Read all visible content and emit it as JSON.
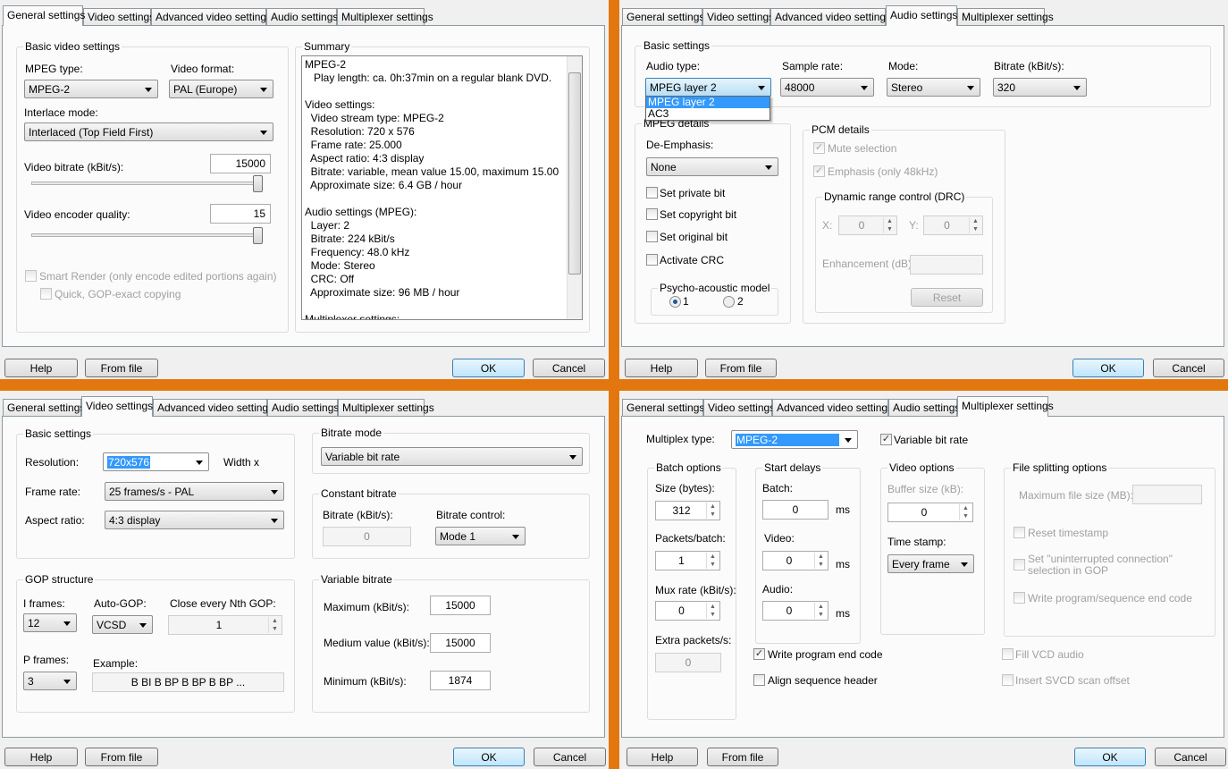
{
  "tabs": [
    "General settings",
    "Video settings",
    "Advanced video settings",
    "Audio settings",
    "Multiplexer settings"
  ],
  "buttons": {
    "help": "Help",
    "from_file": "From file",
    "ok": "OK",
    "cancel": "Cancel"
  },
  "accent_color": "#e2770f",
  "general": {
    "basic_group": "Basic video settings",
    "mpeg_type_label": "MPEG type:",
    "mpeg_type": "MPEG-2",
    "video_format_label": "Video format:",
    "video_format": "PAL (Europe)",
    "interlace_label": "Interlace mode:",
    "interlace": "Interlaced (Top Field First)",
    "bitrate_label": "Video bitrate (kBit/s):",
    "bitrate": "15000",
    "bitrate_slider_percent": 100,
    "quality_label": "Video encoder quality:",
    "quality": "15",
    "quality_slider_percent": 100,
    "smart_render": "Smart Render (only encode edited portions again)",
    "quick_gop": "Quick, GOP-exact copying",
    "summary_group": "Summary",
    "summary_text": "MPEG-2\n   Play length: ca. 0h:37min on a regular blank DVD.\n\nVideo settings:\n  Video stream type: MPEG-2\n  Resolution: 720 x 576\n  Frame rate: 25.000\n  Aspect ratio: 4:3 display\n  Bitrate: variable, mean value 15.00, maximum 15.00\n  Approximate size: 6.4 GB / hour\n\nAudio settings (MPEG):\n  Layer: 2\n  Bitrate: 224 kBit/s\n  Frequency: 48.0 kHz\n  Mode: Stereo\n  CRC: Off\n  Approximate size: 96 MB / hour\n\nMultiplexer settings:"
  },
  "audio": {
    "basic_group": "Basic settings",
    "audio_type_label": "Audio type:",
    "audio_type": "MPEG layer 2",
    "audio_type_options": [
      "MPEG layer 2",
      "AC3"
    ],
    "sample_rate_label": "Sample rate:",
    "sample_rate": "48000",
    "mode_label": "Mode:",
    "mode": "Stereo",
    "bitrate_label": "Bitrate (kBit/s):",
    "bitrate": "320",
    "mpeg_group": "MPEG details",
    "deemphasis_label": "De-Emphasis:",
    "deemphasis": "None",
    "private_bit": "Set private bit",
    "copyright_bit": "Set copyright bit",
    "original_bit": "Set original bit",
    "crc": "Activate CRC",
    "psycho_group": "Psycho-acoustic model",
    "psycho_1": "1",
    "psycho_2": "2",
    "pcm_group": "PCM details",
    "mute": "Mute selection",
    "emphasis": "Emphasis (only 48kHz)",
    "drc_group": "Dynamic range control (DRC)",
    "x_label": "X:",
    "x": "0",
    "y_label": "Y:",
    "y": "0",
    "enhancement_label": "Enhancement (dB)",
    "reset": "Reset"
  },
  "video": {
    "basic_group": "Basic settings",
    "resolution_label": "Resolution:",
    "resolution": "720x576",
    "width_label": "Width x",
    "frame_rate_label": "Frame rate:",
    "frame_rate": "25 frames/s - PAL",
    "aspect_label": "Aspect ratio:",
    "aspect": "4:3 display",
    "gop_group": "GOP structure",
    "i_frames_label": "I frames:",
    "i_frames": "12",
    "auto_gop_label": "Auto-GOP:",
    "auto_gop": "VCSD",
    "close_gop_label": "Close every Nth GOP:",
    "close_gop": "1",
    "p_frames_label": "P frames:",
    "p_frames": "3",
    "example_label": "Example:",
    "example": "B BI B BP B BP B BP ...",
    "bitrate_mode_group": "Bitrate mode",
    "bitrate_mode": "Variable bit rate",
    "constant_group": "Constant bitrate",
    "cbr_label": "Bitrate (kBit/s):",
    "cbr": "0",
    "control_label": "Bitrate control:",
    "control": "Mode 1",
    "variable_group": "Variable bitrate",
    "max_label": "Maximum (kBit/s):",
    "max": "15000",
    "medium_label": "Medium value (kBit/s):",
    "medium": "15000",
    "min_label": "Minimum (kBit/s):",
    "min": "1874"
  },
  "mux": {
    "type_label": "Multiplex type:",
    "type": "MPEG-2",
    "vbr": "Variable bit rate",
    "batch_group": "Batch options",
    "size_label": "Size (bytes):",
    "size": "312",
    "packets_label": "Packets/batch:",
    "packets": "1",
    "muxrate_label": "Mux rate (kBit/s):",
    "muxrate": "0",
    "extra_label": "Extra packets/s:",
    "extra": "0",
    "delays_group": "Start delays",
    "batch_label": "Batch:",
    "batch": "0",
    "video_label": "Video:",
    "video": "0",
    "audio_label": "Audio:",
    "audio": "0",
    "ms": "ms",
    "write_end": "Write program end code",
    "align_seq": "Align sequence header",
    "video_group": "Video options",
    "buffer_label": "Buffer size (kB):",
    "buffer": "0",
    "timestamp_label": "Time stamp:",
    "timestamp": "Every frame",
    "split_group": "File splitting options",
    "max_file_label": "Maximum file size (MB):",
    "reset_ts": "Reset timestamp",
    "uninterrupted_1": "Set \"uninterrupted connection\"",
    "uninterrupted_2": "selection in GOP",
    "write_seq_end": "Write program/sequence end code",
    "fill_vcd": "Fill VCD audio",
    "insert_svcd": "Insert SVCD scan offset"
  }
}
